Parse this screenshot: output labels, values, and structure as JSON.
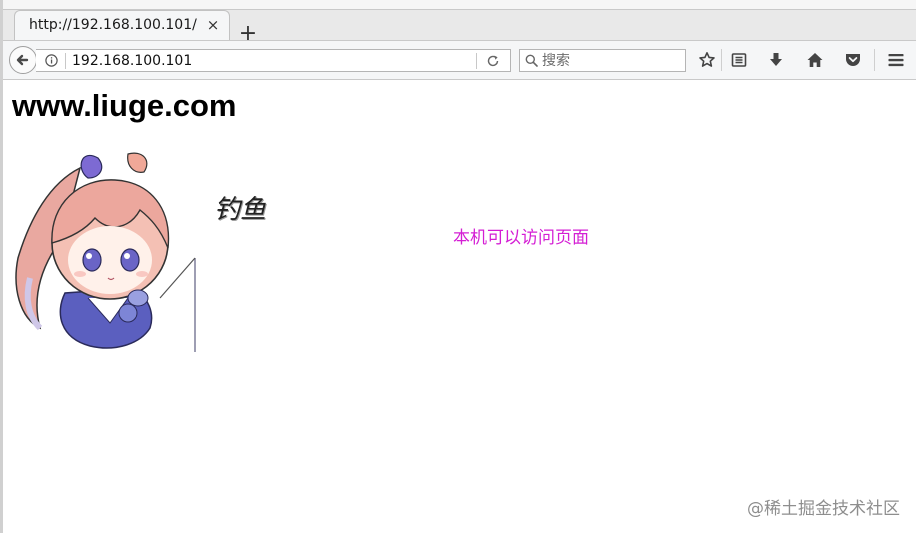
{
  "browser": {
    "tab": {
      "title": "http://192.168.100.101/",
      "close_glyph": "×"
    },
    "new_tab_glyph": "+",
    "url": "192.168.100.101",
    "search_placeholder": "搜索",
    "toolbar_icons": [
      "back-icon",
      "info-icon",
      "reload-icon",
      "search-icon",
      "star-icon",
      "reading-list-icon",
      "download-icon",
      "home-icon",
      "pocket-icon",
      "menu-icon"
    ]
  },
  "page": {
    "heading": "www.liuge.com",
    "image_caption": "钓鱼",
    "message": "本机可以访问页面",
    "message_color": "#d41ed4"
  },
  "watermark": "@稀土掘金技术社区"
}
